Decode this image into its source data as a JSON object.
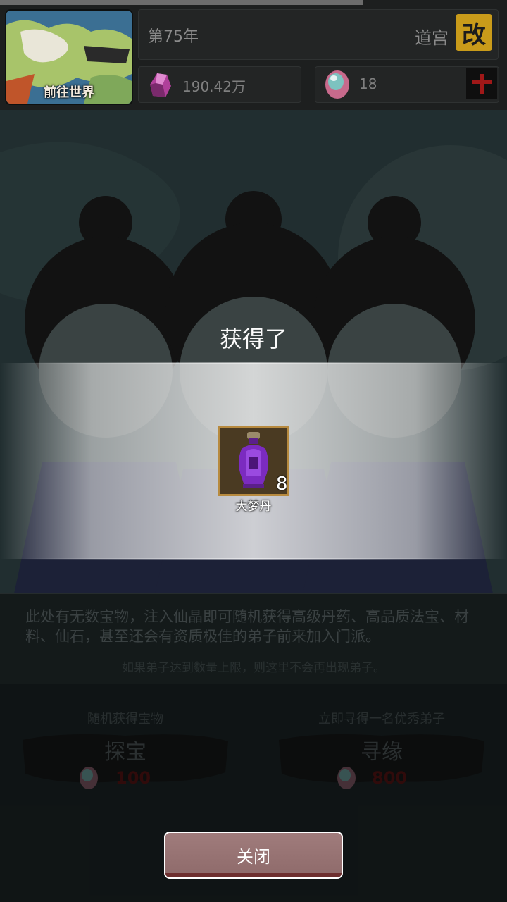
{
  "header": {
    "map_button_label": "前往世界",
    "year": "第75年",
    "sect_name": "道宫",
    "rename_label": "改",
    "resources": {
      "crystal_amount": "190.42万",
      "stone_amount": "18"
    }
  },
  "description": {
    "text": "此处有无数宝物，注入仙晶即可随机获得高级丹药、高品质法宝、材料、仙石，甚至还会有资质极佳的弟子前来加入门派。",
    "note": "如果弟子达到数量上限，则这里不会再出现弟子。"
  },
  "actions": [
    {
      "caption": "随机获得宝物",
      "label": "探宝",
      "cost": "100"
    },
    {
      "caption": "立即寻得一名优秀弟子",
      "label": "寻缘",
      "cost": "800"
    }
  ],
  "reward_popup": {
    "title": "获得了",
    "item": {
      "name": "大梦丹",
      "count": "8",
      "icon": "purple-pill-bottle-icon"
    },
    "close_label": "关闭"
  },
  "colors": {
    "accent_gold": "#c99b1a",
    "close_button": "#9c7878",
    "cost_red": "#4a1212"
  }
}
